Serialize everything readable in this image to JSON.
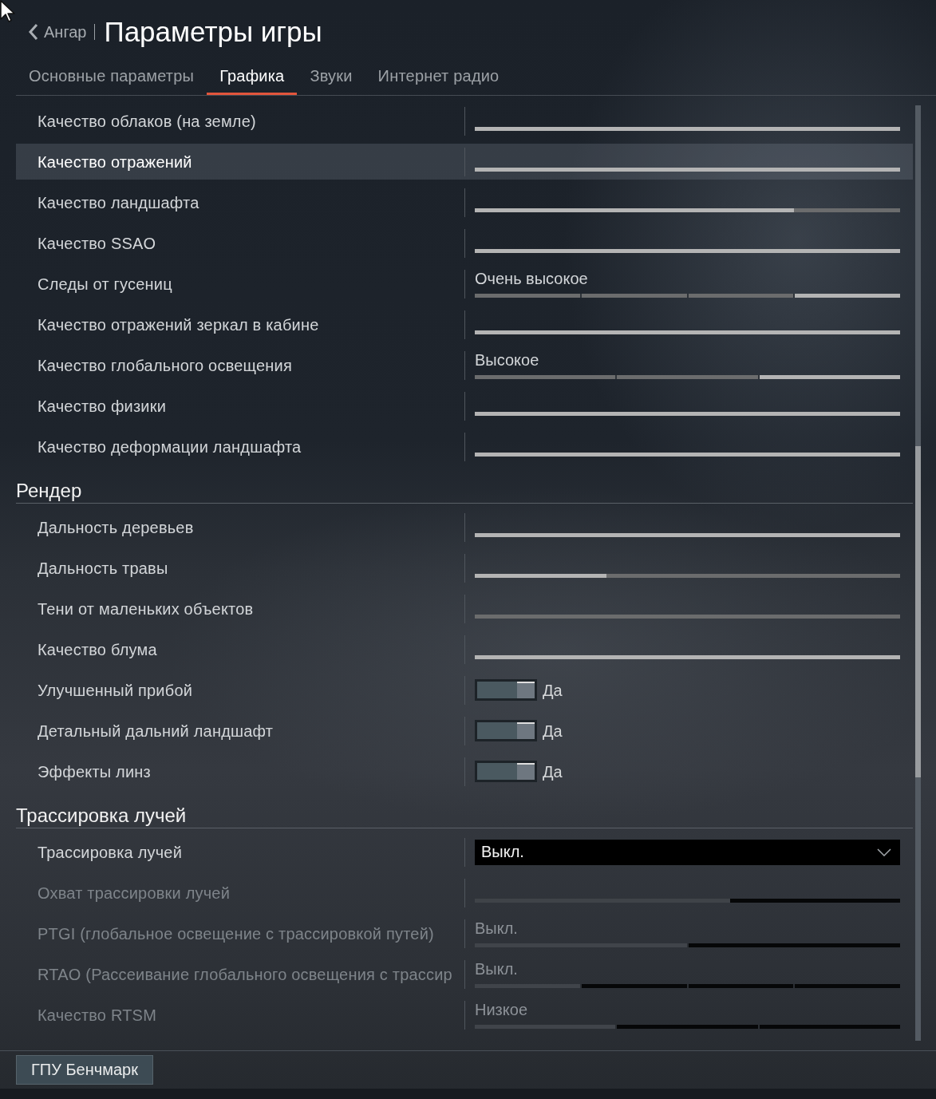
{
  "header": {
    "back_label": "Ангар",
    "title": "Параметры игры"
  },
  "tabs": [
    {
      "label": "Основные параметры",
      "selected": false
    },
    {
      "label": "Графика",
      "selected": true
    },
    {
      "label": "Звуки",
      "selected": false
    },
    {
      "label": "Интернет радио",
      "selected": false
    }
  ],
  "sections": [
    {
      "rows": [
        {
          "label": "Качество облаков (на земле)",
          "kind": "slider",
          "level": 1,
          "selected": false,
          "disabled": false
        },
        {
          "label": "Качество отражений",
          "kind": "slider",
          "level": 1,
          "selected": true,
          "disabled": false
        },
        {
          "label": "Качество ландшафта",
          "kind": "slider",
          "level": 0.75,
          "selected": false,
          "disabled": false
        },
        {
          "label": "Качество SSAO",
          "kind": "slider",
          "level": 1,
          "selected": false,
          "disabled": false
        },
        {
          "label": "Следы от гусениц",
          "kind": "steps",
          "value": "Очень высокое",
          "segments": [
            {
              "selected": false
            },
            {
              "selected": false
            },
            {
              "selected": false
            },
            {
              "selected": true
            }
          ],
          "selected": false,
          "disabled": false
        },
        {
          "label": "Качество отражений зеркал в кабине",
          "kind": "slider",
          "level": 1,
          "selected": false,
          "disabled": false
        },
        {
          "label": "Качество глобального освещения",
          "kind": "steps",
          "value": "Высокое",
          "segments": [
            {
              "selected": false
            },
            {
              "selected": false
            },
            {
              "selected": true
            }
          ],
          "selected": false,
          "disabled": false
        },
        {
          "label": "Качество физики",
          "kind": "slider",
          "level": 1,
          "selected": false,
          "disabled": false
        },
        {
          "label": "Качество деформации ландшафта",
          "kind": "slider",
          "level": 1,
          "selected": false,
          "disabled": false
        }
      ]
    },
    {
      "title": "Рендер",
      "rows": [
        {
          "label": "Дальность деревьев",
          "kind": "slider",
          "level": 1,
          "selected": false,
          "disabled": false
        },
        {
          "label": "Дальность травы",
          "kind": "slider",
          "level": 0.31,
          "selected": false,
          "disabled": false
        },
        {
          "label": "Тени от маленьких объектов",
          "kind": "slider",
          "level": 0,
          "selected": false,
          "disabled": false
        },
        {
          "label": "Качество блума",
          "kind": "slider",
          "level": 1,
          "selected": false,
          "disabled": false
        },
        {
          "label": "Улучшенный прибой",
          "kind": "toggle",
          "on": true,
          "value": "Да",
          "selected": false,
          "disabled": false
        },
        {
          "label": "Детальный дальний ландшафт",
          "kind": "toggle",
          "on": true,
          "value": "Да",
          "selected": false,
          "disabled": false
        },
        {
          "label": "Эффекты линз",
          "kind": "toggle",
          "on": true,
          "value": "Да",
          "selected": false,
          "disabled": false
        }
      ]
    },
    {
      "title": "Трассировка лучей",
      "rows": [
        {
          "label": "Трассировка лучей",
          "kind": "dropdown",
          "value": "Выкл.",
          "selected": false,
          "disabled": false
        },
        {
          "label": "Охват трассировки лучей",
          "kind": "slider",
          "level": 0.6,
          "selected": false,
          "disabled": true
        },
        {
          "label": "PTGI (глобальное освещение с трассировкой путей)",
          "kind": "steps",
          "value": "Выкл.",
          "segments": [
            {
              "selected": true
            },
            {
              "selected": false
            }
          ],
          "selected": false,
          "disabled": true
        },
        {
          "label": "RTAO (Рассеивание глобального освещения с трассир",
          "kind": "steps",
          "value": "Выкл.",
          "segments": [
            {
              "selected": true
            },
            {
              "selected": false
            },
            {
              "selected": false
            },
            {
              "selected": false
            }
          ],
          "selected": false,
          "disabled": true
        },
        {
          "label": "Качество RTSM",
          "kind": "steps",
          "value": "Низкое",
          "segments": [
            {
              "selected": true
            },
            {
              "selected": false
            },
            {
              "selected": false
            }
          ],
          "selected": false,
          "disabled": true
        }
      ]
    }
  ],
  "footer": {
    "button": "ГПУ Бенчмарк"
  }
}
